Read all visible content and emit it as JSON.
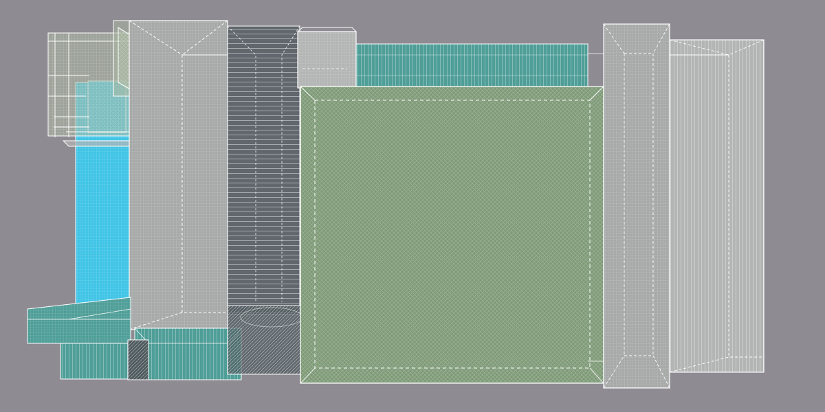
{
  "viewport": {
    "background": "#8e8b93",
    "edge_color": "#ffffff",
    "hidden_edge_style": "dashed"
  },
  "materials": {
    "cyan_mesh": "#3fc4e6",
    "teal_mesh": "#4f9e98",
    "sage_mesh": "#7f9b78",
    "sage_light": "#a9b8a0",
    "gray_panel": "#a7a9a9",
    "gray_light": "#b3b5b4",
    "slate_lines": "#3c4a4e",
    "dark_slate": "#4e5a5e"
  }
}
